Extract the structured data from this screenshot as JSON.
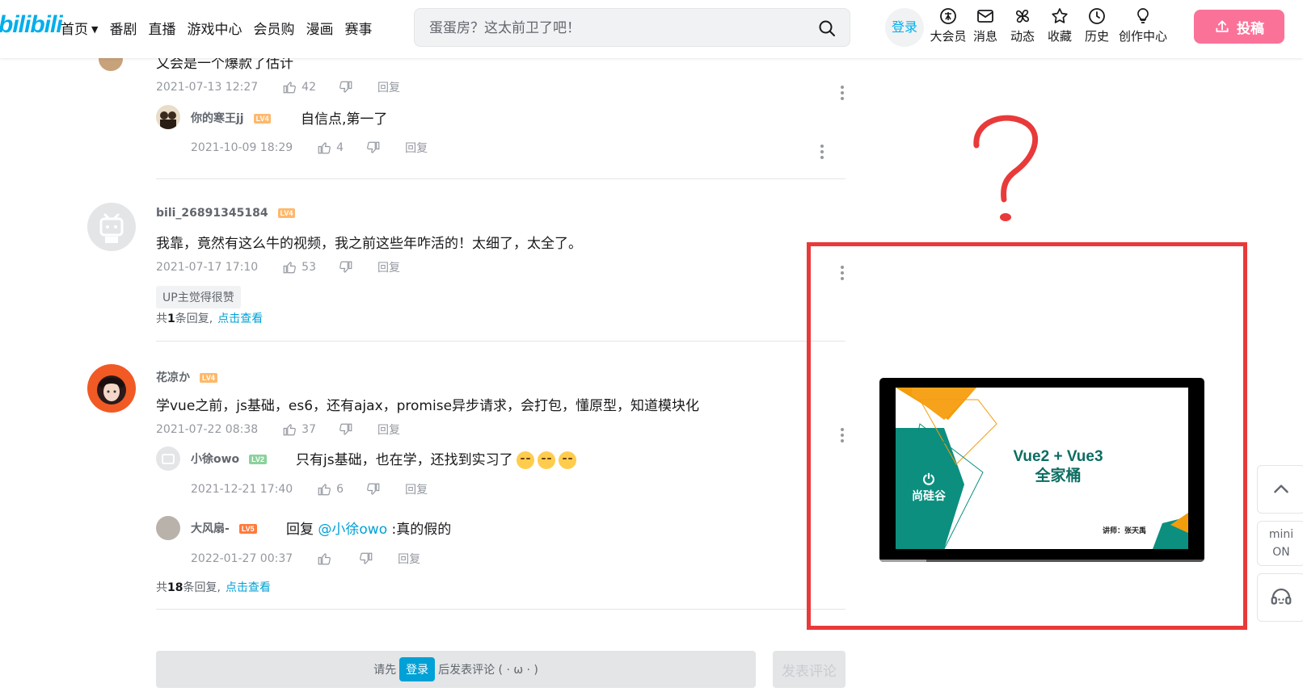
{
  "header": {
    "logo": "bilibili",
    "nav": [
      "首页",
      "番剧",
      "直播",
      "游戏中心",
      "会员购",
      "漫画",
      "赛事"
    ],
    "search_placeholder": "蛋蛋房？这太前卫了吧！",
    "login": "登录",
    "icons": [
      {
        "label": "大会员",
        "icon": "vip-icon"
      },
      {
        "label": "消息",
        "icon": "mail-icon"
      },
      {
        "label": "动态",
        "icon": "pinwheel-icon"
      },
      {
        "label": "收藏",
        "icon": "star-icon"
      },
      {
        "label": "历史",
        "icon": "clock-icon"
      },
      {
        "label": "创作中心",
        "icon": "lightbulb-icon"
      }
    ],
    "upload": "投稿"
  },
  "comments": {
    "c0": {
      "text": "又会是一个爆款了估计",
      "time": "2021-07-13 12:27",
      "likes": "42",
      "reply": "回复",
      "sub": {
        "user": "你的寒王jj",
        "level": "LV4",
        "text": "自信点,第一了",
        "time": "2021-10-09 18:29",
        "likes": "4",
        "reply": "回复"
      }
    },
    "c1": {
      "user": "bili_26891345184",
      "level": "LV4",
      "text": "我靠，竟然有这么牛的视频，我之前这些年咋活的！太细了，太全了。",
      "time": "2021-07-17 17:10",
      "likes": "53",
      "reply": "回复",
      "tag": "UP主觉得很赞",
      "summary_pre": "共",
      "summary_count": "1",
      "summary_post": "条回复,",
      "summary_link": "点击查看"
    },
    "c2": {
      "user": "花凉か",
      "level": "LV4",
      "text": "学vue之前，js基础，es6，还有ajax，promise异步请求，会打包，懂原型，知道模块化",
      "time": "2021-07-22 08:38",
      "likes": "37",
      "reply": "回复",
      "sub1": {
        "user": "小徐owo",
        "level": "LV2",
        "text": "只有js基础，也在学，还找到实习了",
        "time": "2021-12-21 17:40",
        "likes": "6",
        "reply": "回复"
      },
      "sub2": {
        "user": "大风扇-",
        "level": "LV5",
        "pre": "回复",
        "at": "@小徐owo",
        "text": ":真的假的",
        "time": "2022-01-27 00:37",
        "reply": "回复"
      },
      "summary_pre": "共",
      "summary_count": "18",
      "summary_post": "条回复,",
      "summary_link": "点击查看"
    }
  },
  "comment_box": {
    "pre": "请先",
    "login": "登录",
    "post": "后发表评论 ( · ω · )",
    "submit": "发表评论"
  },
  "video": {
    "title_line1": "Vue2 + Vue3",
    "title_line2": "全家桶",
    "brand": "尚硅谷",
    "lecturer": "讲师：张天禹"
  },
  "side": {
    "mini_line1": "mini",
    "mini_line2": "ON"
  },
  "colors": {
    "accent": "#00aeec",
    "pink": "#fb7299",
    "annotation_red": "#e83a3a",
    "teal": "#0c8f7f",
    "orange": "#f39c0c"
  }
}
